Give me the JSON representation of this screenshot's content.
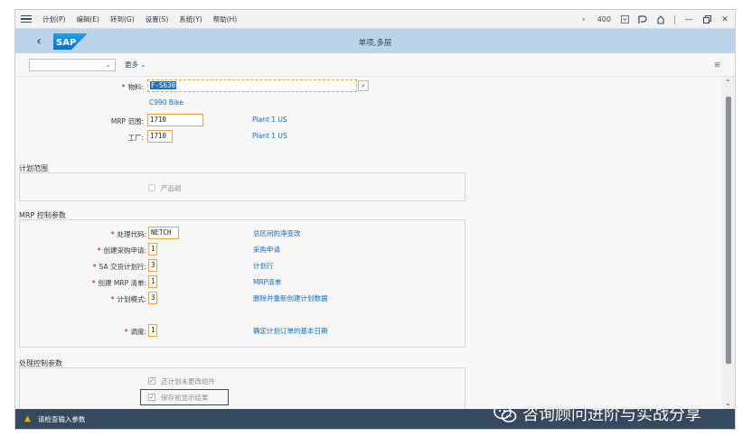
{
  "menubar": {
    "items": [
      "计划(P)",
      "编辑(E)",
      "转到(G)",
      "设置(S)",
      "系统(Y)",
      "帮助(H)"
    ],
    "client": "400"
  },
  "shellbar": {
    "logo": "SAP",
    "title": "单项,多层"
  },
  "toolbar": {
    "variant_value": "",
    "more_label": "更多"
  },
  "form": {
    "material": {
      "label": "物料:",
      "value": "F-S630",
      "description": "C990 Bike"
    },
    "mrp_area": {
      "label": "MRP 范围:",
      "value": "1710",
      "description": "Plant 1 US"
    },
    "plant": {
      "label": "工厂:",
      "value": "1710",
      "description": "Plant 1 US"
    }
  },
  "planning_scope": {
    "title": "计划范围",
    "product_group": {
      "label": "产品组",
      "checked": false
    }
  },
  "mrp_control": {
    "title": "MRP 控制参数",
    "fields": [
      {
        "label": "处理代码:",
        "value": "NETCH",
        "description": "总区间的净变改"
      },
      {
        "label": "创建采购申请:",
        "value": "1",
        "description": "采购申请"
      },
      {
        "label": "SA 交货计划行:",
        "value": "3",
        "description": "计划行"
      },
      {
        "label": "创建 MRP 清单:",
        "value": "1",
        "description": "MRP清单"
      },
      {
        "label": "计划模式:",
        "value": "3",
        "description": "删除并重新创建计划数据"
      },
      {
        "label": "调度:",
        "value": "1",
        "description": "确定计划订单的基本日期"
      }
    ]
  },
  "process_control": {
    "title": "处理控制参数",
    "options": [
      {
        "label": "还计划未更改组件",
        "checked": true
      },
      {
        "label": "保存前显示结果",
        "checked": true
      }
    ]
  },
  "status": {
    "message": "请检查输入参数"
  },
  "watermark": {
    "text": "咨询顾问进阶与实战分享"
  }
}
